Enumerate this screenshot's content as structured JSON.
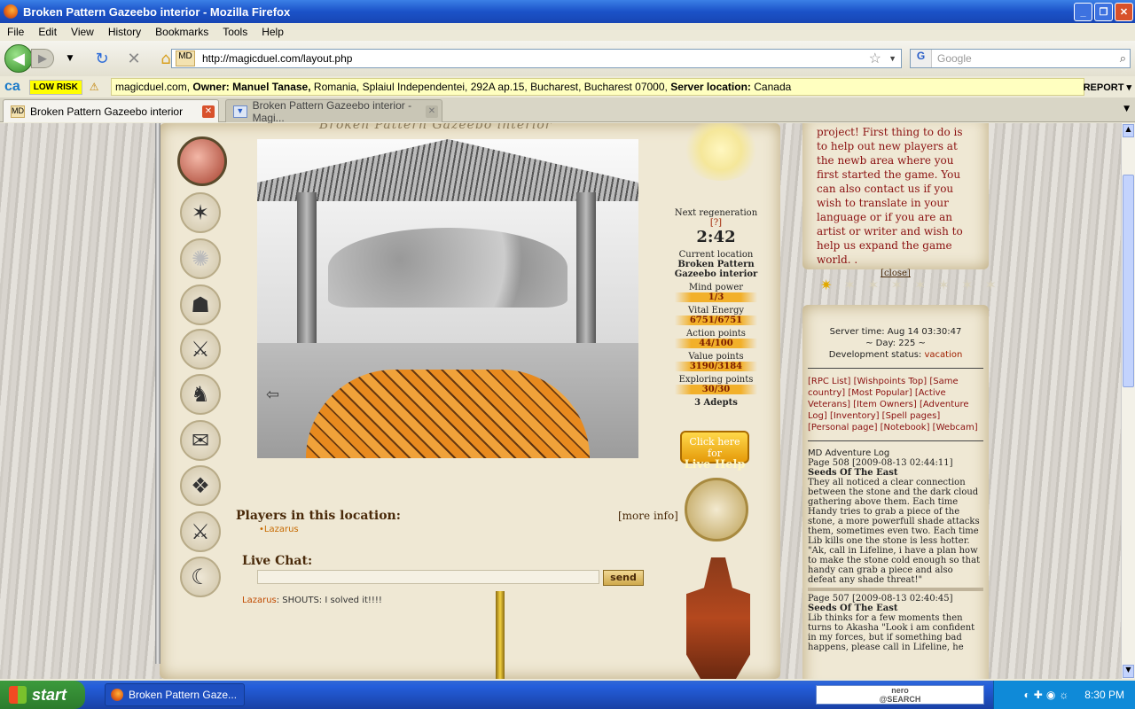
{
  "window": {
    "title": "Broken Pattern Gazeebo interior - Mozilla Firefox"
  },
  "menu": [
    "File",
    "Edit",
    "View",
    "History",
    "Bookmarks",
    "Tools",
    "Help"
  ],
  "nav": {
    "url": "http://magicduel.com/layout.php",
    "search_placeholder": "Google"
  },
  "security": {
    "risk": "LOW RISK",
    "site": "magicduel.com,",
    "owner_label": "Owner:",
    "owner": "Manuel Tanase,",
    "address": "Romania, Splaiul Independentei, 292A ap.15, Bucharest, Bucharest 07000,",
    "server_label": "Server location:",
    "server": "Canada",
    "report": "REPORT"
  },
  "tabs": [
    {
      "label": "Broken Pattern Gazeebo interior"
    },
    {
      "label": "Broken Pattern Gazeebo interior - Magi..."
    }
  ],
  "game": {
    "location_title": "Broken Pattern Gazeebo interior",
    "regen_label": "Next regeneration",
    "regen_help": "[?]",
    "regen_time": "2:42",
    "current_location_label": "Current location",
    "current_location": "Broken Pattern Gazeebo interior",
    "mind_label": "Mind power",
    "mind": "1/3",
    "vital_label": "Vital Energy",
    "vital": "6751/6751",
    "action_label": "Action points",
    "action": "44/100",
    "value_label": "Value points",
    "value": "3190/3184",
    "explore_label": "Exploring points",
    "explore": "30/30",
    "adepts": "3 Adepts",
    "help_line1": "Click here for",
    "help_line2": "Live Help",
    "players_label": "Players in this location:",
    "more_info": "[more info]",
    "player": "•Lazarus",
    "chat_label": "Live Chat:",
    "send": "send",
    "chat_name": "Lazarus",
    "chat_msg": ": SHOUTS: I solved it!!!!"
  },
  "notice": {
    "text": "project! First thing to do is to help out new players at the newb area where you first started the game. You can also contact us if you wish to translate in your language or if you are an artist or writer and wish to help us expand the game world. .",
    "close": "[close]"
  },
  "server": {
    "time": "Server time: Aug 14 03:30:47",
    "day": "~ Day: 225 ~",
    "dev_label": "Development status:",
    "dev": "vacation"
  },
  "links": "[RPC List] [Wishpoints Top] [Same country] [Most Popular] [Active Veterans] [Item Owners] [Adventure Log] [Inventory] [Spell pages] [Personal page] [Notebook] [Webcam]",
  "log": {
    "title": "MD Adventure Log",
    "e1_head": "Page 508 [2009-08-13 02:44:11]",
    "e1_title": "Seeds Of The East",
    "e1_text": "They all noticed a clear connection between the stone and the dark cloud gathering above them. Each time Handy tries to grab a piece of the stone, a more powerfull shade attacks them, sometimes even two. Each time Lib kills one the stone is less hotter. \"Ak, call in Lifeline, i have a plan how to make the stone cold enough so that handy can grab a piece and also defeat any shade threat!\"",
    "e2_head": "Page 507 [2009-08-13 02:40:45]",
    "e2_title": "Seeds Of The East",
    "e2_text": "Lib thinks for a few moments then turns to Akasha \"Look i am confident in my forces, but if something bad happens, please call in Lifeline, he"
  },
  "taskbar": {
    "start": "start",
    "item": "Broken Pattern Gaze...",
    "nero_line1": "nero",
    "nero_line2": "@SEARCH",
    "clock": "8:30 PM"
  }
}
